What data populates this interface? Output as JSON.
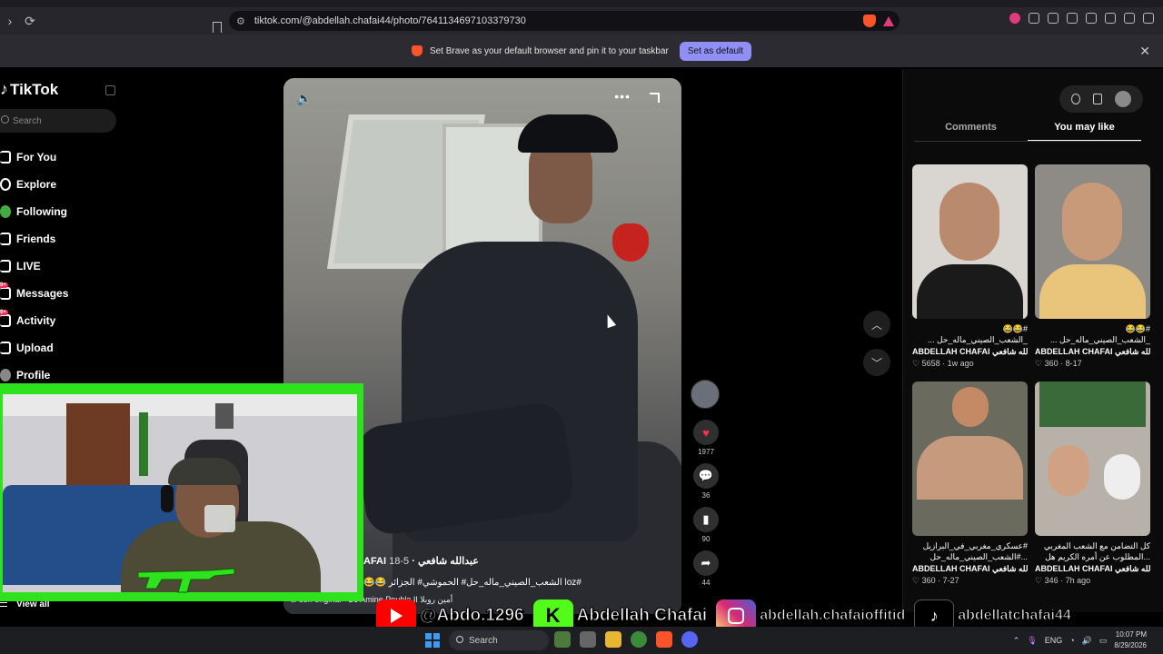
{
  "browser": {
    "url": "tiktok.com/@abdellah.chafai44/photo/7641134697103379730",
    "infobar_text": "Set Brave as your default browser and pin it to your taskbar",
    "infobar_button": "Set as default",
    "infobar_close": "✕"
  },
  "sidebar": {
    "logo": "TikTok",
    "search_placeholder": "Search",
    "items": [
      {
        "label": "For You",
        "icon": "home-icon"
      },
      {
        "label": "Explore",
        "icon": "compass-icon"
      },
      {
        "label": "Following",
        "icon": "following-icon"
      },
      {
        "label": "Friends",
        "icon": "friends-icon"
      },
      {
        "label": "LIVE",
        "icon": "live-icon"
      },
      {
        "label": "Messages",
        "icon": "messages-icon",
        "badge": "9+"
      },
      {
        "label": "Activity",
        "icon": "activity-icon",
        "badge": "9+"
      },
      {
        "label": "Upload",
        "icon": "upload-icon"
      },
      {
        "label": "Profile",
        "icon": "profile-icon"
      }
    ],
    "view_all": "View all"
  },
  "video": {
    "author": "AFAI",
    "author_arabic": "عبدالله شافعي",
    "date": "5-18",
    "description": "😂😂 الشعب_الصيني_ماله_حل# الحموشي# الجزائر loz#",
    "music": "son original - DJ Amine Pouhla II أمين روبلا"
  },
  "actions": {
    "likes": "1977",
    "comments": "36",
    "saves": "90",
    "shares": "44"
  },
  "panel": {
    "tabs": [
      "Comments",
      "You may like"
    ],
    "active_tab": "You may like",
    "cards": [
      {
        "title": "#😂😂_الشعب_الصيني_ماله_حل ...",
        "author": "ABDELLAH CHAFAI عبدالله شافعي",
        "views": "5658",
        "date": "1w ago",
        "skin": "#b98a6d",
        "bg": "#d9d6d2"
      },
      {
        "title": "#😂😂_الشعب_الصيني_ماله_حل ...",
        "author": "ABDELLAH CHAFAI عبدالله شافعي",
        "views": "360",
        "date": "8-17",
        "skin": "#c99a7a",
        "bg": "#8e8b86"
      },
      {
        "title": "#عسكري_مغربي_في_البرازيل ...#الشعب_الصيني_ماله_حل",
        "author": "ABDELLAH CHAFAI عبدالله شافعي",
        "views": "360",
        "date": "7-27",
        "skin": "#c48a66",
        "bg": "#6b6a5e"
      },
      {
        "title": "كل التضامن مع الشعب المغربي ...المطلوب عن أمره الكريم هل",
        "author": "ABDELLAH CHAFAI عبدالله شافعي",
        "views": "346",
        "date": "7h ago",
        "skin": "#d1a184",
        "bg": "#b7b1a9"
      }
    ]
  },
  "banner": {
    "youtube": "@Abdo.1296",
    "kick": "Abdellah Chafai",
    "instagram": "abdellah.chafaioffitid",
    "tiktok": "abdellatchafai44",
    "kick_letter": "K",
    "tiktok_glyph": "♪"
  },
  "taskbar": {
    "search": "Search",
    "lang": "ENG",
    "time": "10:07 PM",
    "date": "8/29/2026"
  },
  "colors": {
    "accent_pink": "#fe2c55",
    "webcam_border": "#2ee21d",
    "brave": "#fb542b"
  }
}
